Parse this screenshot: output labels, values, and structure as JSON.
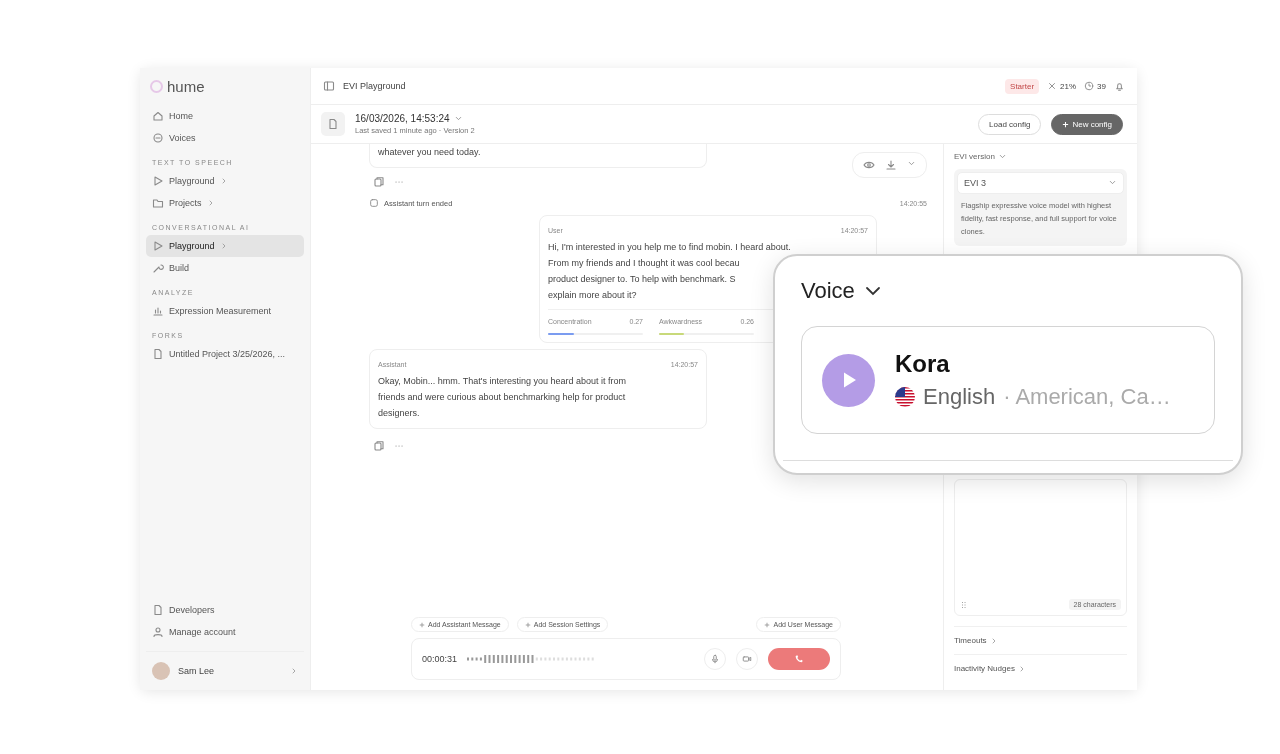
{
  "sidebar": {
    "logo": "hume",
    "sections": [
      {
        "items": [
          {
            "label": "Home",
            "selected": false,
            "expandable": false
          },
          {
            "label": "Voices",
            "selected": false,
            "expandable": false
          }
        ]
      },
      {
        "heading": "TEXT TO SPEECH",
        "items": [
          {
            "label": "Playground",
            "selected": false,
            "expandable": true
          },
          {
            "label": "Projects",
            "selected": false,
            "expandable": true
          }
        ]
      },
      {
        "heading": "CONVERSATIONAL AI",
        "items": [
          {
            "label": "Playground",
            "selected": true,
            "expandable": true
          },
          {
            "label": "Build",
            "selected": false,
            "expandable": false
          }
        ]
      },
      {
        "heading": "ANALYZE",
        "items": [
          {
            "label": "Expression Measurement",
            "selected": false,
            "expandable": false
          }
        ]
      },
      {
        "heading": "FORKS",
        "items": [
          {
            "label": "Untitled Project 3/25/2026, ...",
            "selected": false,
            "expandable": false
          }
        ]
      }
    ],
    "footer": [
      {
        "label": "Developers"
      },
      {
        "label": "Manage account"
      }
    ],
    "user": {
      "name": "Sam Lee"
    }
  },
  "top_bar": {
    "title": "EVI Playground",
    "plan": "Starter",
    "usage": "21%",
    "credits": "39"
  },
  "session": {
    "title": "16/03/2026, 14:53:24",
    "subtitle": "Last saved 1 minute ago · Version 2",
    "buttons": [
      {
        "label": "Load config",
        "kind": "secondary"
      },
      {
        "label": "New config",
        "kind": "primary"
      }
    ]
  },
  "chat": {
    "partial_message": "whatever you need today.",
    "turn_event": {
      "label": "Assistant turn ended",
      "time": "14:20:55"
    },
    "messages": [
      {
        "role": "User",
        "time": "14:20:57",
        "lines": [
          "Hi, I'm interested in you help me to find mobin. I heard about.",
          "From my friends and I thought it was cool becau",
          "product designer to. To help with benchmark. S",
          "explain more about it?"
        ],
        "emotions": [
          {
            "name": "Concentration",
            "score": "0.27",
            "level": 0.27,
            "color": "#7b9cf0"
          },
          {
            "name": "Awkwardness",
            "score": "0.26",
            "level": 0.26,
            "color": "#c8d97a"
          }
        ]
      },
      {
        "role": "Assistant",
        "time": "14:20:57",
        "lines": [
          "Okay, Mobin... hmm. That's interesting you heard about it from",
          "friends and were curious about benchmarking help for product",
          "designers."
        ]
      }
    ],
    "actions": [
      "Add Assistant Message",
      "Add Session Settings",
      "Add User Message"
    ],
    "call": {
      "timer": "00:00:31"
    }
  },
  "config_panel": {
    "version_label": "EVI version",
    "version": "EVI 3",
    "version_description": "Flagship expressive voice model with highest fidelity, fast response, and full support for voice clones.",
    "character_count": "28 characters",
    "sections": [
      "Timeouts",
      "Inactivity Nudges"
    ]
  },
  "voice_callout": {
    "title": "Voice",
    "voice": {
      "name": "Kora",
      "language": "English",
      "details": "· American, Ca…"
    }
  }
}
